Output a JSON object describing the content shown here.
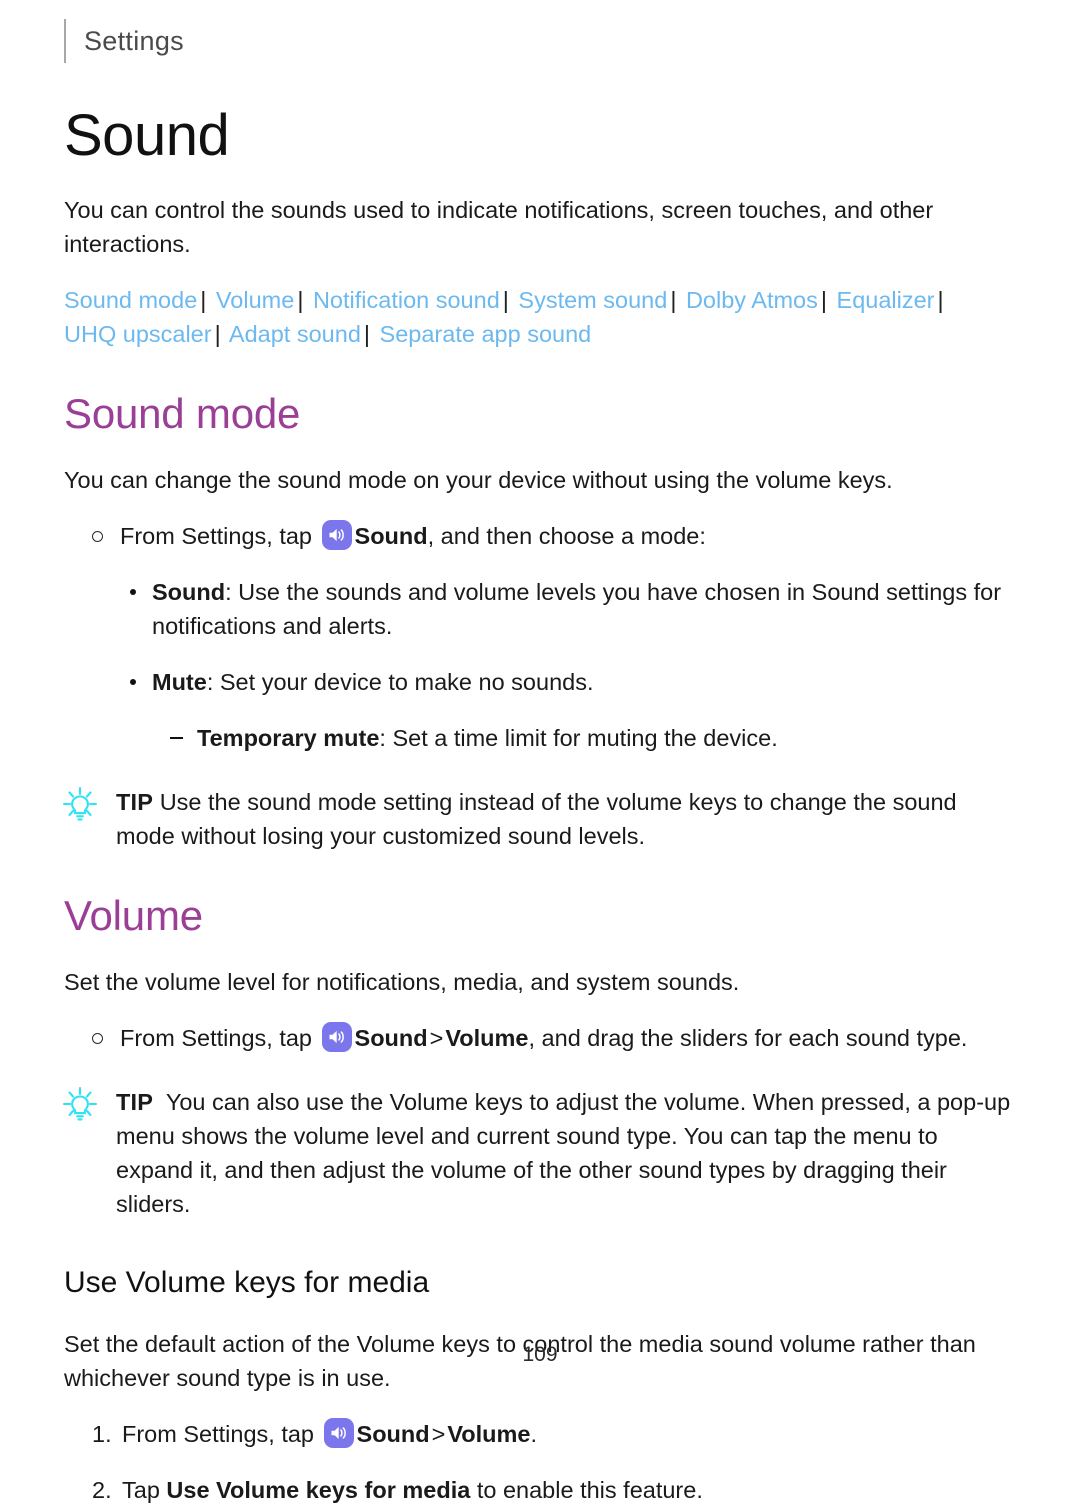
{
  "header": {
    "label": "Settings"
  },
  "page_title": "Sound",
  "intro": "You can control the sounds used to indicate notifications, screen touches, and other interactions.",
  "nav_links": {
    "separator": "|",
    "items": [
      "Sound mode",
      "Volume",
      "Notification sound",
      "System sound",
      "Dolby Atmos",
      "Equalizer",
      "UHQ upscaler",
      "Adapt sound",
      "Separate app sound"
    ]
  },
  "sound_mode": {
    "heading": "Sound mode",
    "intro": "You can change the sound mode on your device without using the volume keys.",
    "step": {
      "pre": "From Settings, tap",
      "icon": "sound-icon",
      "bold": "Sound",
      "post": ", and then choose a mode:"
    },
    "options": [
      {
        "bold": "Sound",
        "text": ": Use the sounds and volume levels you have chosen in Sound settings for notifications and alerts."
      },
      {
        "bold": "Mute",
        "text": ": Set your device to make no sounds."
      }
    ],
    "sub_option": {
      "bold": "Temporary mute",
      "text": ": Set a time limit for muting the device."
    },
    "tip": {
      "label": "TIP",
      "text": "Use the sound mode setting instead of the volume keys to change the sound mode without losing your customized sound levels."
    }
  },
  "volume": {
    "heading": "Volume",
    "intro": "Set the volume level for notifications, media, and system sounds.",
    "step": {
      "pre": "From Settings, tap",
      "icon": "sound-icon",
      "bold1": "Sound",
      "chevron": ">",
      "bold2": "Volume",
      "post": ", and drag the sliders for each sound type."
    },
    "tip": {
      "label": "TIP",
      "text": "You can also use the Volume keys to adjust the volume. When pressed, a pop-up menu shows the volume level and current sound type. You can tap the menu to expand it, and then adjust the volume of the other sound types by dragging their sliders."
    },
    "sub_section": {
      "heading": "Use Volume keys for media",
      "intro": "Set the default action of the Volume keys to control the media sound volume rather than whichever sound type is in use.",
      "steps": [
        {
          "number": "1.",
          "pre": "From Settings, tap",
          "icon": "sound-icon",
          "bold1": "Sound",
          "chevron": ">",
          "bold2": "Volume",
          "post": "."
        },
        {
          "number": "2.",
          "pre": "Tap",
          "bold1": "Use Volume keys for media",
          "post": " to enable this feature."
        }
      ]
    }
  },
  "page_number": "109",
  "colors": {
    "link": "#6CB9F0",
    "section_heading": "#9B3F96",
    "sound_icon_bg": "#7B76EC",
    "tip_icon": "#2FE3F5",
    "body_text": "#1A1A1A"
  }
}
